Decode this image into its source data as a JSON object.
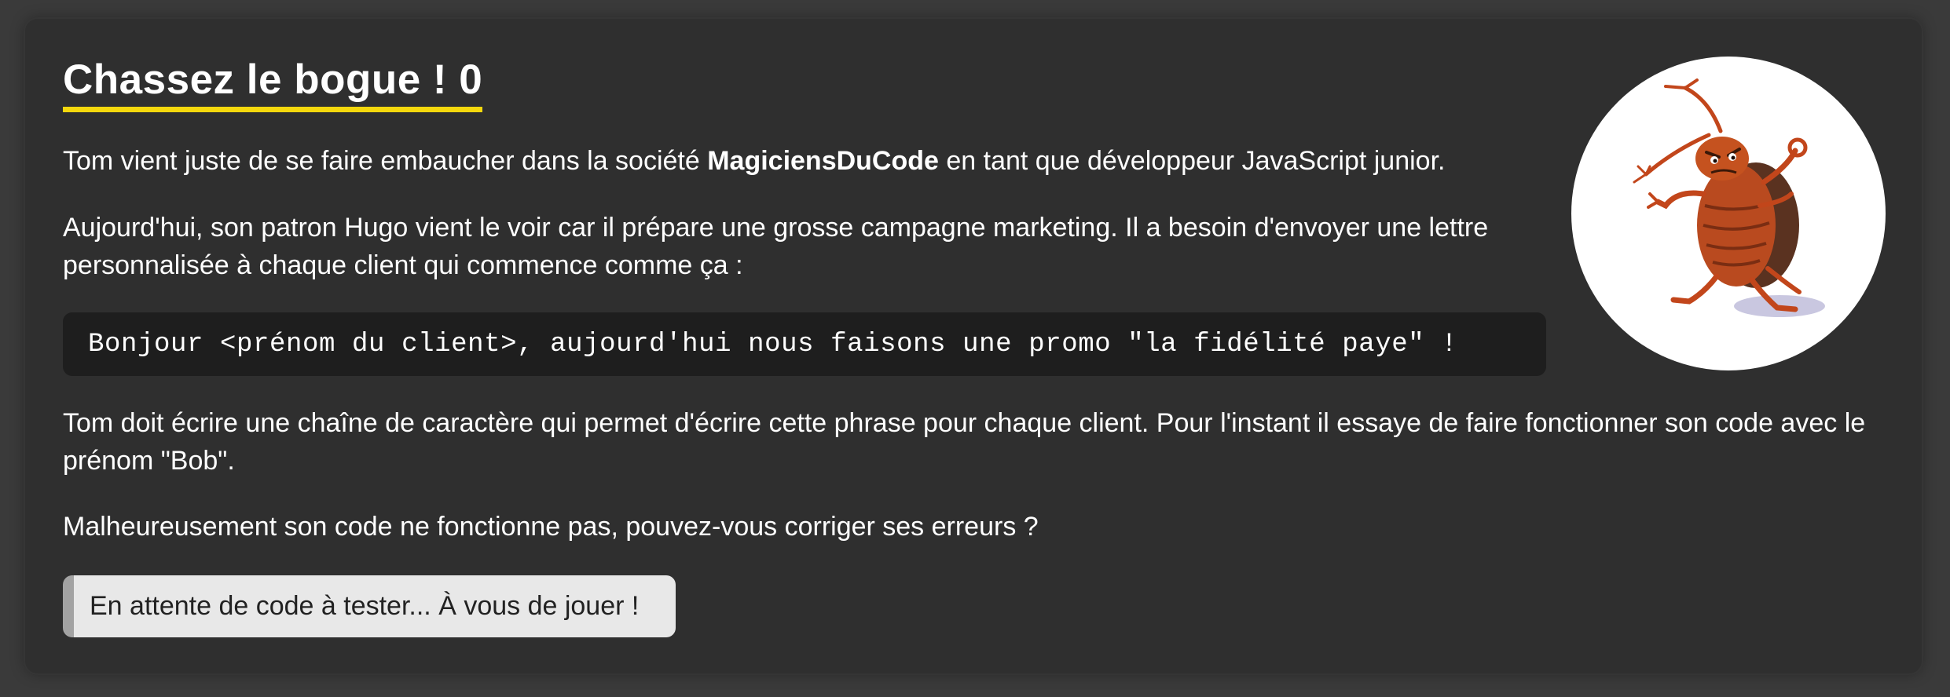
{
  "challenge": {
    "title": "Chassez le bogue ! 0",
    "intro": {
      "before": "Tom vient juste de se faire embaucher dans la société ",
      "company": "MagiciensDuCode",
      "after": " en tant que développeur JavaScript junior."
    },
    "context": "Aujourd'hui, son patron Hugo vient le voir car il prépare une grosse campagne marketing. Il a besoin d'envoyer une lettre personnalisée à chaque client qui commence comme ça :",
    "code_sample": "Bonjour <prénom du client>, aujourd'hui nous faisons une promo \"la fidélité paye\" !",
    "task": "Tom doit écrire une chaîne de caractère qui permet d'écrire cette phrase pour chaque client. Pour l'instant il essaye de faire fonctionner son code avec le prénom \"Bob\".",
    "question": "Malheureusement son code ne fonctionne pas, pouvez-vous corriger ses erreurs ?",
    "status": "En attente de code à tester... À vous de jouer !"
  },
  "illustration": {
    "icon": "bug-mascot-icon"
  },
  "colors": {
    "background": "#3a3a3a",
    "panel": "#2f2f2f",
    "title_underline": "#f5d80d",
    "code_background": "#1e1e1e",
    "status_background": "#e8e8e8",
    "status_accent": "#a3a3a3"
  }
}
